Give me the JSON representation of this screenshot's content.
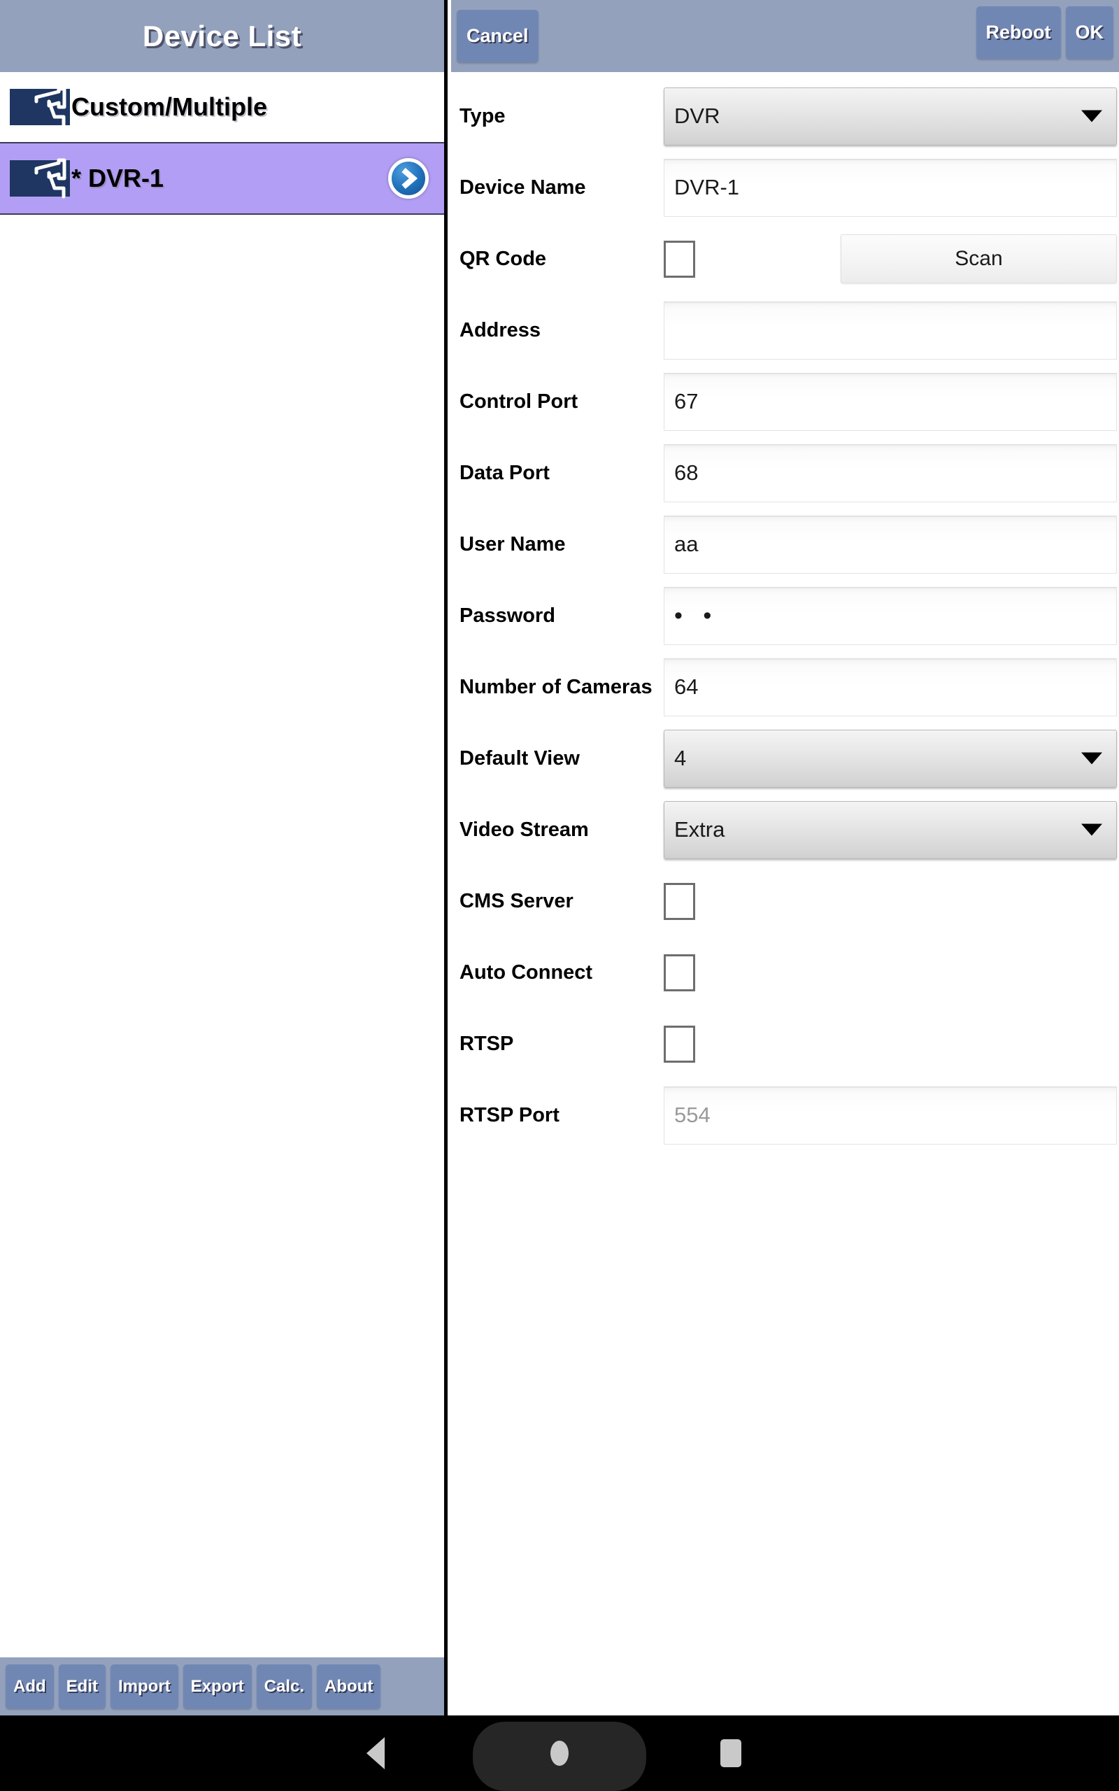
{
  "left": {
    "header_title": "Device List",
    "devices": [
      {
        "label": "Custom/Multiple",
        "selected": false,
        "has_chevron": false,
        "icon": "cctv-camera-icon"
      },
      {
        "label": "* DVR-1",
        "selected": true,
        "has_chevron": true,
        "icon": "cctv-camera-icon"
      }
    ],
    "toolbar": [
      {
        "label": "Add"
      },
      {
        "label": "Edit"
      },
      {
        "label": "Import"
      },
      {
        "label": "Export"
      },
      {
        "label": "Calc."
      },
      {
        "label": "About"
      }
    ]
  },
  "right": {
    "header": {
      "cancel_label": "Cancel",
      "reboot_label": "Reboot",
      "ok_label": "OK"
    },
    "form": [
      {
        "label": "Type",
        "kind": "dropdown",
        "value": "DVR"
      },
      {
        "label": "Device Name",
        "kind": "text",
        "value": "DVR-1"
      },
      {
        "label": "QR Code",
        "kind": "checkbox_scan",
        "checked": false,
        "button_label": "Scan"
      },
      {
        "label": "Address",
        "kind": "text",
        "value": ""
      },
      {
        "label": "Control Port",
        "kind": "text",
        "value": "67"
      },
      {
        "label": "Data Port",
        "kind": "text",
        "value": "68"
      },
      {
        "label": "User Name",
        "kind": "text",
        "value": "aa"
      },
      {
        "label": "Password",
        "kind": "password",
        "value": "• •"
      },
      {
        "label": "Number of Cameras",
        "kind": "text",
        "value": "64"
      },
      {
        "label": "Default View",
        "kind": "dropdown",
        "value": "4"
      },
      {
        "label": "Video Stream",
        "kind": "dropdown",
        "value": "Extra"
      },
      {
        "label": "CMS Server",
        "kind": "checkbox",
        "checked": false
      },
      {
        "label": "Auto Connect",
        "kind": "checkbox",
        "checked": false
      },
      {
        "label": "RTSP",
        "kind": "checkbox",
        "checked": false
      },
      {
        "label": "RTSP Port",
        "kind": "text_placeholder",
        "value": "",
        "placeholder": "554"
      }
    ]
  },
  "navbar": {
    "back": "back-triangle-icon",
    "home": "home-pill-icon",
    "recent": "recent-apps-icon"
  },
  "colors": {
    "header_bar": "#93a1bd",
    "button": "#7187b3",
    "selected_row": "#b39ef5",
    "icon_navy": "#1e3661",
    "chevron_blue": "#1f6fba"
  }
}
